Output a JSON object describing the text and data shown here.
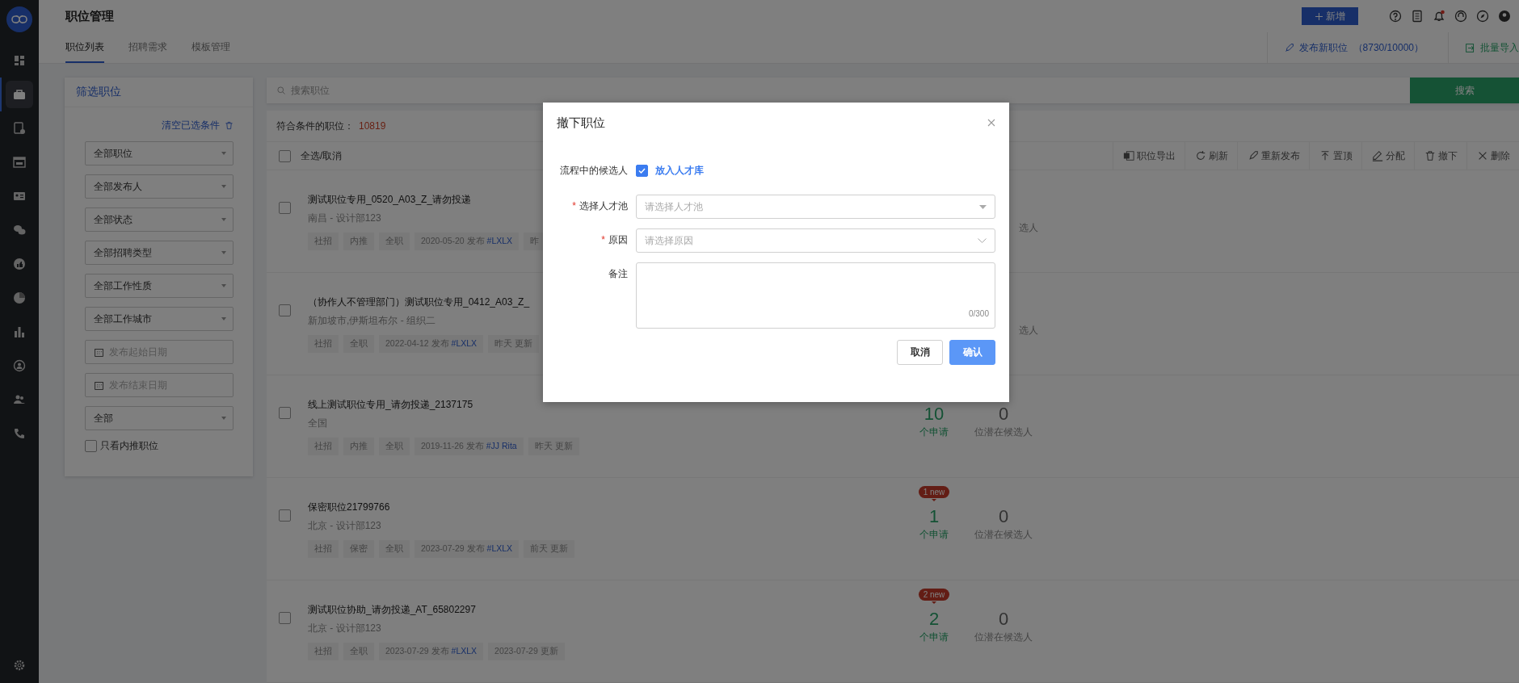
{
  "sidebar": {
    "items": [
      {
        "selected": false
      },
      {
        "selected": true
      },
      {
        "selected": false
      },
      {
        "selected": false
      },
      {
        "selected": false
      },
      {
        "selected": false
      },
      {
        "selected": false
      },
      {
        "selected": false
      },
      {
        "selected": false
      },
      {
        "selected": false
      },
      {
        "selected": false
      },
      {
        "selected": false
      }
    ]
  },
  "header": {
    "title": "职位管理",
    "new_button": "新增",
    "tabs": [
      {
        "label": "职位列表",
        "selected": true
      },
      {
        "label": "招聘需求",
        "selected": false
      },
      {
        "label": "模板管理",
        "selected": false
      }
    ],
    "actions": [
      {
        "label": "发布新职位",
        "count": "（8730/10000）"
      },
      {
        "label": "批量导入"
      }
    ]
  },
  "filter": {
    "title": "筛选职位",
    "clear": "清空已选条件",
    "fields": [
      {
        "kind": "select",
        "value": "全部职位"
      },
      {
        "kind": "select",
        "value": "全部发布人"
      },
      {
        "kind": "select",
        "value": "全部状态"
      },
      {
        "kind": "select",
        "value": "全部招聘类型"
      },
      {
        "kind": "select",
        "value": "全部工作性质"
      },
      {
        "kind": "select",
        "value": "全部工作城市"
      },
      {
        "kind": "date",
        "placeholder": "发布起始日期"
      },
      {
        "kind": "date",
        "placeholder": "发布结束日期"
      },
      {
        "kind": "select",
        "value": "全部"
      }
    ],
    "referral_only": {
      "label": "只看内推职位",
      "checked": false
    }
  },
  "search": {
    "placeholder": "搜索职位",
    "button": "搜索"
  },
  "result": {
    "label": "符合条件的职位：",
    "count": "10819"
  },
  "select_all": {
    "label": "全选/取消",
    "checked": false
  },
  "toolbar": [
    {
      "label": "职位导出"
    },
    {
      "label": "刷新"
    },
    {
      "label": "重新发布"
    },
    {
      "label": "置顶"
    },
    {
      "label": "分配"
    },
    {
      "label": "撤下"
    },
    {
      "label": "删除"
    }
  ],
  "jobs": [
    {
      "checked": false,
      "title": "测试职位专用_0520_A03_Z_请勿投递",
      "location": "南昌 - 设计部123",
      "tags": [
        {
          "text": "社招"
        },
        {
          "text": "内推"
        },
        {
          "text": "全职"
        },
        {
          "text": "2020-05-20 发布",
          "link": "#LXLX"
        },
        {
          "text": "昨"
        }
      ],
      "stats": {
        "candidates_label": "选人"
      }
    },
    {
      "checked": false,
      "title": "（协作人不管理部门）测试职位专用_0412_A03_Z_",
      "location": "新加坡市,伊斯坦布尔 - 组织二",
      "tags": [
        {
          "text": "社招"
        },
        {
          "text": "全职"
        },
        {
          "text": "2022-04-12 发布",
          "link": "#LXLX"
        },
        {
          "text": "昨天 更新"
        }
      ],
      "stats": {
        "candidates_label": "选人"
      }
    },
    {
      "checked": false,
      "title": "线上测试职位专用_请勿投递_2137175",
      "location": "全国",
      "tags": [
        {
          "text": "社招"
        },
        {
          "text": "内推"
        },
        {
          "text": "全职"
        },
        {
          "text": "2019-11-26 发布",
          "link": "#JJ Rita"
        },
        {
          "text": "昨天 更新"
        }
      ],
      "stats": {
        "applications": "10",
        "applications_label": "个申请",
        "candidates": "0",
        "candidates_label": "位潜在候选人"
      }
    },
    {
      "checked": false,
      "title": "保密职位21799766",
      "location": "北京 - 设计部123",
      "tags": [
        {
          "text": "社招"
        },
        {
          "text": "保密"
        },
        {
          "text": "全职"
        },
        {
          "text": "2023-07-29 发布",
          "link": "#LXLX"
        },
        {
          "text": "前天 更新"
        }
      ],
      "stats": {
        "badge": "1 new",
        "applications": "1",
        "applications_label": "个申请",
        "candidates": "0",
        "candidates_label": "位潜在候选人"
      }
    },
    {
      "checked": false,
      "title": "测试职位协助_请勿投递_AT_65802297",
      "location": "北京 - 设计部123",
      "tags": [
        {
          "text": "社招"
        },
        {
          "text": "全职"
        },
        {
          "text": "2023-07-29 发布",
          "link": "#LXLX"
        },
        {
          "text": "2023-07-29 更新"
        }
      ],
      "stats": {
        "badge": "2 new",
        "applications": "2",
        "applications_label": "个申请",
        "candidates": "0",
        "candidates_label": "位潜在候选人"
      }
    }
  ],
  "modal": {
    "title": "撤下职位",
    "candidates_label": "流程中的候选人",
    "talent_pool": {
      "label": "放入人才库",
      "checked": true
    },
    "fields": [
      {
        "kind": "select",
        "label": "选择人才池",
        "required_mark": "*",
        "placeholder": "请选择人才池"
      },
      {
        "kind": "cascader",
        "label": "原因",
        "required_mark": "*",
        "placeholder": "请选择原因"
      },
      {
        "kind": "textarea",
        "label": "备注",
        "counter": "0/300"
      }
    ],
    "buttons": [
      {
        "label": "取消",
        "primary": false
      },
      {
        "label": "确认",
        "primary": true
      }
    ]
  }
}
